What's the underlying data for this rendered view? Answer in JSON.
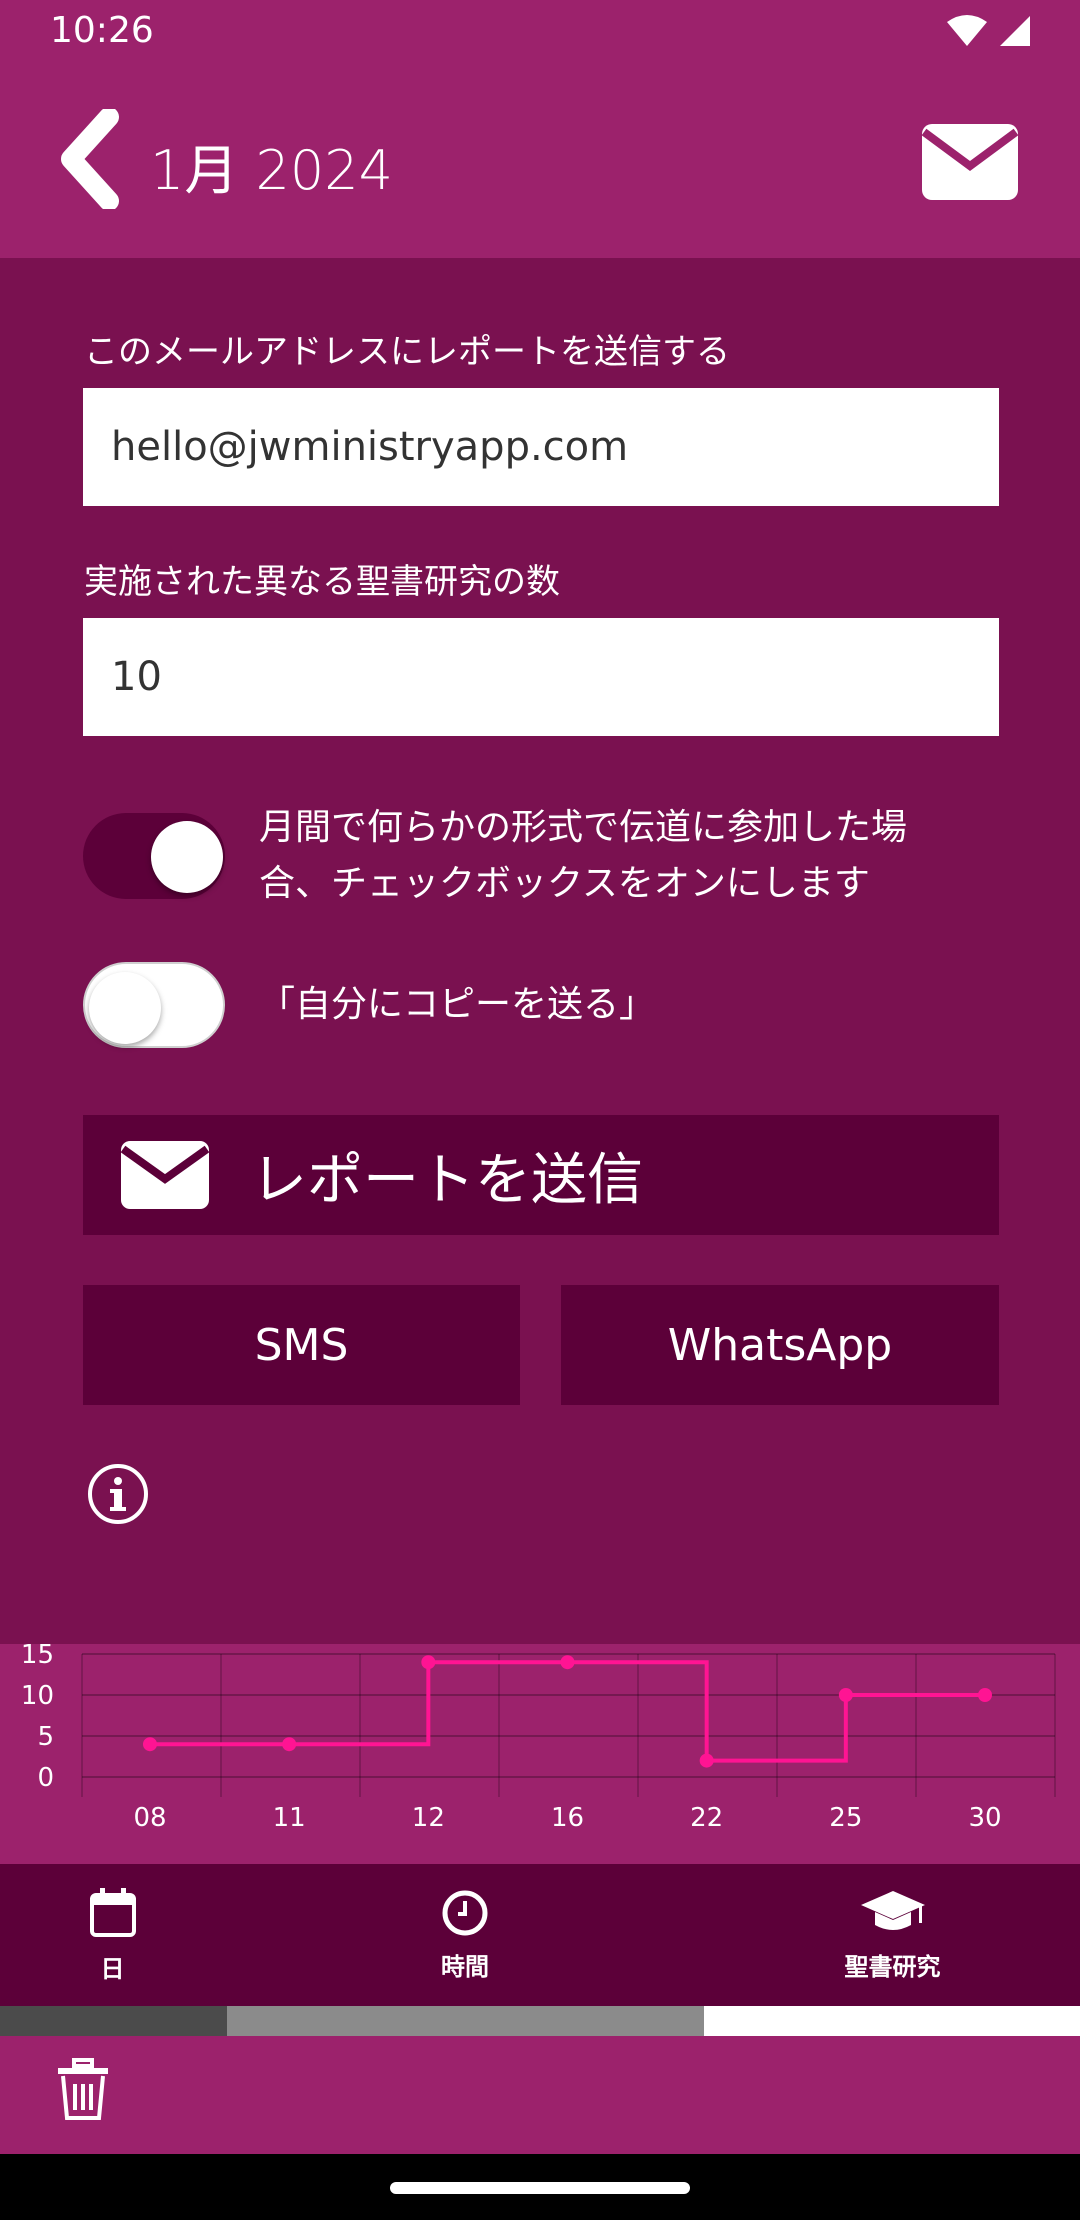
{
  "status_bar": {
    "time": "10:26"
  },
  "app_bar": {
    "title": "1月 2024"
  },
  "form": {
    "email_label": "このメールアドレスにレポートを送信する",
    "email_value": "hello@jwministryapp.com",
    "studies_label": "実施された異なる聖書研究の数",
    "studies_value": "10",
    "participated_label_line1": "月間で何らかの形式で伝道に参加した場",
    "participated_label_line2": "合、チェックボックスをオンにします",
    "participated_checked": true,
    "copy_label": "「自分にコピーを送る」",
    "copy_checked": false
  },
  "actions": {
    "send_report": "レポートを送信",
    "sms": "SMS",
    "whatsapp": "WhatsApp"
  },
  "chart_data": {
    "type": "line",
    "categories": [
      "08",
      "11",
      "12",
      "16",
      "22",
      "25",
      "30"
    ],
    "series": [
      {
        "values": [
          4,
          4,
          14,
          14,
          2,
          10,
          10
        ]
      }
    ],
    "yticks": [
      "15",
      "10",
      "5",
      "0"
    ],
    "ylim": [
      0,
      15
    ],
    "step": true,
    "grid": true,
    "colors": {
      "line": "#ff1493"
    }
  },
  "bottom_nav": {
    "items": [
      {
        "label": "日",
        "icon": "calendar-icon"
      },
      {
        "label": "時間",
        "icon": "clock-icon"
      },
      {
        "label": "聖書研究",
        "icon": "graduation-cap-icon"
      }
    ]
  },
  "progress": {
    "active_tab_index": 2
  },
  "colors": {
    "primary": "#9c226c",
    "content_bg": "#7a1150",
    "dark": "#5c0039",
    "chart_line": "#ff1493"
  }
}
